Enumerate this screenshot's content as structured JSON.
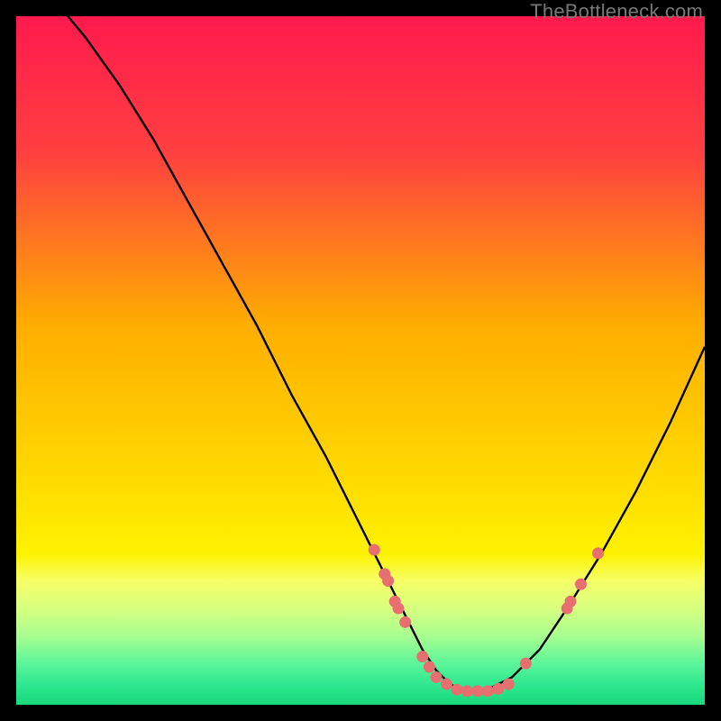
{
  "watermark": "TheBottleneck.com",
  "chart_data": {
    "type": "line",
    "title": "",
    "xlabel": "",
    "ylabel": "",
    "xlim": [
      0,
      100
    ],
    "ylim": [
      0,
      100
    ],
    "curve": {
      "name": "bottleneck-curve",
      "x": [
        0,
        5,
        10,
        15,
        20,
        25,
        30,
        35,
        40,
        45,
        50,
        55,
        57,
        59,
        61,
        63,
        65,
        68,
        72,
        76,
        80,
        85,
        90,
        95,
        100
      ],
      "y": [
        108,
        103,
        97,
        90,
        82,
        73,
        64,
        55,
        45,
        36,
        26,
        16,
        12,
        8,
        5,
        3,
        2,
        2,
        4,
        8,
        14,
        22,
        31,
        41,
        52
      ]
    },
    "points": {
      "name": "highlight-dots",
      "color": "#e76f6f",
      "xy": [
        [
          52,
          22.5
        ],
        [
          53.5,
          19
        ],
        [
          54,
          18
        ],
        [
          55,
          15
        ],
        [
          55.5,
          14
        ],
        [
          56.5,
          12
        ],
        [
          59,
          7
        ],
        [
          60,
          5.5
        ],
        [
          61,
          4
        ],
        [
          62.5,
          3
        ],
        [
          64,
          2.2
        ],
        [
          65.5,
          2
        ],
        [
          67,
          2
        ],
        [
          68.5,
          2
        ],
        [
          70,
          2.3
        ],
        [
          71.5,
          3
        ],
        [
          74,
          6
        ],
        [
          80,
          14
        ],
        [
          80.5,
          15
        ],
        [
          82,
          17.5
        ],
        [
          84.5,
          22
        ]
      ]
    },
    "gradient_bands": [
      {
        "y": 0,
        "color": "#ff1a4d"
      },
      {
        "y": 20,
        "color": "#ff4040"
      },
      {
        "y": 45,
        "color": "#ffae00"
      },
      {
        "y": 70,
        "color": "#ffe000"
      },
      {
        "y": 78,
        "color": "#fff200"
      },
      {
        "y": 82,
        "color": "#f6ff66"
      },
      {
        "y": 86,
        "color": "#d8ff80"
      },
      {
        "y": 90,
        "color": "#a8ff90"
      },
      {
        "y": 94,
        "color": "#5cf59a"
      },
      {
        "y": 97,
        "color": "#30e88f"
      },
      {
        "y": 100,
        "color": "#18d87a"
      }
    ]
  }
}
